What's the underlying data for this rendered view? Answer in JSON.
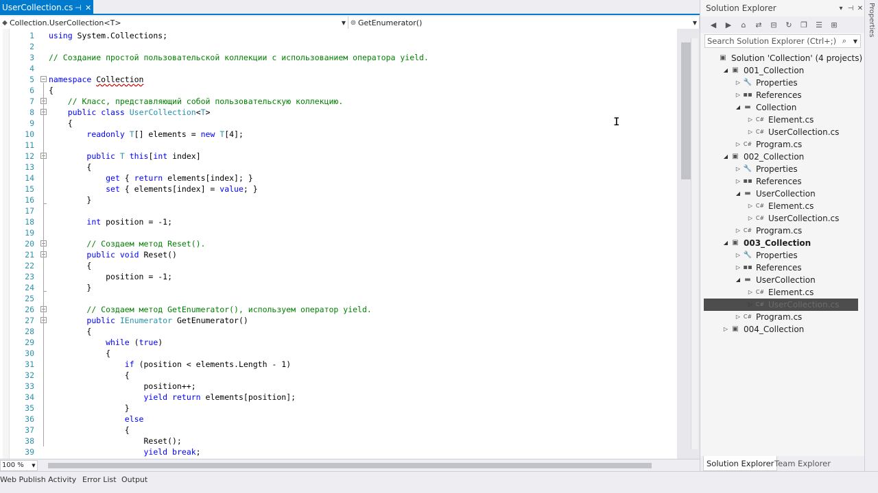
{
  "editor": {
    "tab_title": "UserCollection.cs",
    "tab_pin": "⊣",
    "tab_close": "✕",
    "nav_type": "Collection.UserCollection<T>",
    "nav_member": "GetEnumerator()",
    "zoom": "100 %",
    "lines": [
      {
        "n": "1",
        "fold": null,
        "html": "<span class=\"kw\">using</span> System.Collections;"
      },
      {
        "n": "2",
        "fold": null,
        "html": ""
      },
      {
        "n": "3",
        "fold": null,
        "html": "<span class=\"cm\">// Создание простой пользовательской коллекции с использованием оператора yield.</span>"
      },
      {
        "n": "4",
        "fold": null,
        "html": ""
      },
      {
        "n": "5",
        "fold": "-",
        "html": "<span class=\"kw\">namespace</span> <span class=\"squig\">Collection</span>"
      },
      {
        "n": "6",
        "fold": null,
        "html": "{"
      },
      {
        "n": "7",
        "fold": "-",
        "html": "    <span class=\"cm\">// Класс, представляющий собой пользовательскую коллекцию.</span>"
      },
      {
        "n": "8",
        "fold": "-",
        "html": "    <span class=\"kw\">public</span> <span class=\"kw\">class</span> <span class=\"ty\">UserCollection</span>&lt;<span class=\"ty\">T</span>&gt;"
      },
      {
        "n": "9",
        "fold": null,
        "html": "    {"
      },
      {
        "n": "10",
        "fold": null,
        "html": "        <span class=\"kw\">readonly</span> <span class=\"ty\">T</span>[] elements = <span class=\"kw\">new</span> <span class=\"ty\">T</span>[4];"
      },
      {
        "n": "11",
        "fold": null,
        "html": ""
      },
      {
        "n": "12",
        "fold": "-",
        "html": "        <span class=\"kw\">public</span> <span class=\"ty\">T</span> <span class=\"kw\">this</span>[<span class=\"kw\">int</span> index]"
      },
      {
        "n": "13",
        "fold": null,
        "html": "        {"
      },
      {
        "n": "14",
        "fold": null,
        "html": "            <span class=\"kw\">get</span> { <span class=\"kw\">return</span> elements[index]; }"
      },
      {
        "n": "15",
        "fold": null,
        "html": "            <span class=\"kw\">set</span> { elements[index] = <span class=\"kw\">value</span>; }"
      },
      {
        "n": "16",
        "fold": null,
        "html": "        }"
      },
      {
        "n": "17",
        "fold": null,
        "html": ""
      },
      {
        "n": "18",
        "fold": null,
        "html": "        <span class=\"kw\">int</span> position = -1;"
      },
      {
        "n": "19",
        "fold": null,
        "html": ""
      },
      {
        "n": "20",
        "fold": "-",
        "html": "        <span class=\"cm\">// Создаем метод Reset().</span>"
      },
      {
        "n": "21",
        "fold": "-",
        "html": "        <span class=\"kw\">public</span> <span class=\"kw\">void</span> Reset()"
      },
      {
        "n": "22",
        "fold": null,
        "html": "        {"
      },
      {
        "n": "23",
        "fold": null,
        "html": "            position = -1;"
      },
      {
        "n": "24",
        "fold": null,
        "html": "        }"
      },
      {
        "n": "25",
        "fold": null,
        "html": ""
      },
      {
        "n": "26",
        "fold": "-",
        "html": "        <span class=\"cm\">// Создаем метод GetEnumerator(), используем оператор yield.</span>"
      },
      {
        "n": "27",
        "fold": "-",
        "html": "        <span class=\"kw\">public</span> <span class=\"ty\">IEnumerator</span> GetEnumerator()"
      },
      {
        "n": "28",
        "fold": null,
        "html": "        {"
      },
      {
        "n": "29",
        "fold": null,
        "html": "            <span class=\"kw\">while</span> (<span class=\"kw\">true</span>)"
      },
      {
        "n": "30",
        "fold": null,
        "html": "            {"
      },
      {
        "n": "31",
        "fold": null,
        "html": "                <span class=\"kw\">if</span> (position &lt; elements.Length - 1)"
      },
      {
        "n": "32",
        "fold": null,
        "html": "                {"
      },
      {
        "n": "33",
        "fold": null,
        "html": "                    position++;"
      },
      {
        "n": "34",
        "fold": null,
        "html": "                    <span class=\"kw\">yield</span> <span class=\"kw\">return</span> elements[position];"
      },
      {
        "n": "35",
        "fold": null,
        "html": "                }"
      },
      {
        "n": "36",
        "fold": null,
        "html": "                <span class=\"kw\">else</span>"
      },
      {
        "n": "37",
        "fold": null,
        "html": "                {"
      },
      {
        "n": "38",
        "fold": null,
        "html": "                    Reset();"
      },
      {
        "n": "39",
        "fold": null,
        "html": "                    <span class=\"kw\">yield</span> <span class=\"kw\">break</span>;"
      }
    ]
  },
  "bottom_tabs": [
    "Web Publish Activity",
    "Error List",
    "Output"
  ],
  "solution_explorer": {
    "title": "Solution Explorer",
    "title_buttons": [
      "▾",
      "⊣",
      "✕"
    ],
    "toolbar_icons": [
      "back-icon",
      "forward-icon",
      "home-icon",
      "sync-icon",
      "collapse-icon",
      "refresh-icon",
      "copy-icon",
      "properties-icon",
      "view-code-icon"
    ],
    "search_placeholder": "Search Solution Explorer (Ctrl+;)",
    "tree": [
      {
        "depth": 0,
        "exp": "",
        "icon": "solution",
        "label": "Solution 'Collection' (4 projects)",
        "bold": false
      },
      {
        "depth": 1,
        "exp": "◢",
        "icon": "project",
        "label": "001_Collection",
        "bold": false
      },
      {
        "depth": 2,
        "exp": "▷",
        "icon": "wrench",
        "label": "Properties",
        "bold": false
      },
      {
        "depth": 2,
        "exp": "▷",
        "icon": "refs",
        "label": "References",
        "bold": false
      },
      {
        "depth": 2,
        "exp": "◢",
        "icon": "folder",
        "label": "Collection",
        "bold": false
      },
      {
        "depth": 3,
        "exp": "▷",
        "icon": "cs",
        "label": "Element.cs",
        "bold": false
      },
      {
        "depth": 3,
        "exp": "▷",
        "icon": "cs",
        "label": "UserCollection.cs",
        "bold": false
      },
      {
        "depth": 2,
        "exp": "▷",
        "icon": "cs",
        "label": "Program.cs",
        "bold": false
      },
      {
        "depth": 1,
        "exp": "◢",
        "icon": "project",
        "label": "002_Collection",
        "bold": false
      },
      {
        "depth": 2,
        "exp": "▷",
        "icon": "wrench",
        "label": "Properties",
        "bold": false
      },
      {
        "depth": 2,
        "exp": "▷",
        "icon": "refs",
        "label": "References",
        "bold": false
      },
      {
        "depth": 2,
        "exp": "◢",
        "icon": "folder",
        "label": "UserCollection",
        "bold": false
      },
      {
        "depth": 3,
        "exp": "▷",
        "icon": "cs",
        "label": "Element.cs",
        "bold": false
      },
      {
        "depth": 3,
        "exp": "▷",
        "icon": "cs",
        "label": "UserCollection.cs",
        "bold": false
      },
      {
        "depth": 2,
        "exp": "▷",
        "icon": "cs",
        "label": "Program.cs",
        "bold": false
      },
      {
        "depth": 1,
        "exp": "◢",
        "icon": "project",
        "label": "003_Collection",
        "bold": true
      },
      {
        "depth": 2,
        "exp": "▷",
        "icon": "wrench",
        "label": "Properties",
        "bold": false
      },
      {
        "depth": 2,
        "exp": "▷",
        "icon": "refs",
        "label": "References",
        "bold": false
      },
      {
        "depth": 2,
        "exp": "◢",
        "icon": "folder",
        "label": "UserCollection",
        "bold": false
      },
      {
        "depth": 3,
        "exp": "▷",
        "icon": "cs",
        "label": "Element.cs",
        "bold": false
      },
      {
        "depth": 3,
        "exp": "▷",
        "icon": "cs",
        "label": "UserCollection.cs",
        "bold": false,
        "selected": true
      },
      {
        "depth": 2,
        "exp": "▷",
        "icon": "cs",
        "label": "Program.cs",
        "bold": false
      },
      {
        "depth": 1,
        "exp": "▷",
        "icon": "project",
        "label": "004_Collection",
        "bold": false
      }
    ],
    "tabs": [
      "Solution Explorer",
      "Team Explorer"
    ]
  },
  "properties_strip": "Properties",
  "colors": {
    "accent": "#007acc",
    "keyword": "#0000ff",
    "comment": "#008000",
    "type": "#2b91af",
    "selection": "#4d4d4d"
  }
}
